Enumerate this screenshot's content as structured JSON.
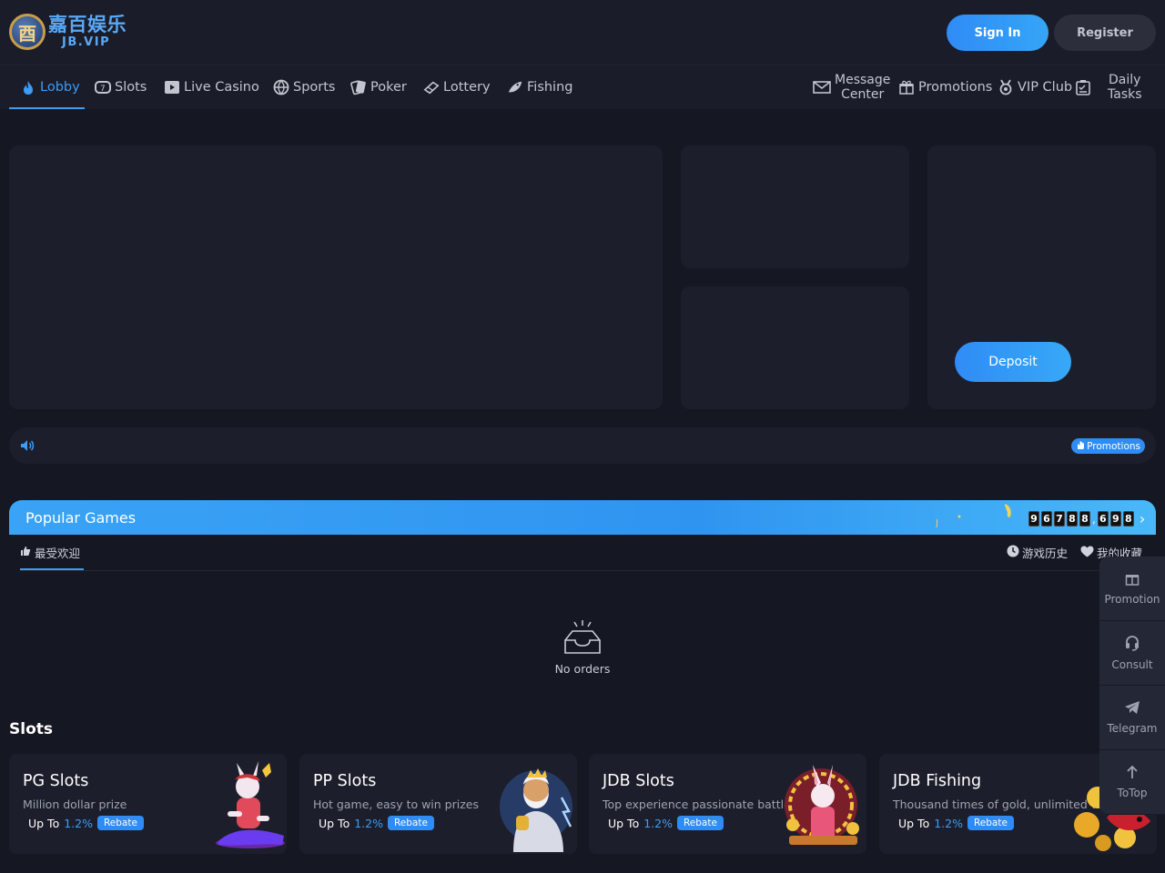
{
  "header": {
    "logo_mark": "酉",
    "logo_cn": "嘉百娱乐",
    "logo_en": "JB.VIP",
    "sign_in": "Sign In",
    "register": "Register"
  },
  "nav": {
    "items": [
      {
        "label": "Lobby",
        "icon": "flame-icon"
      },
      {
        "label": "Slots",
        "icon": "slot-machine-icon"
      },
      {
        "label": "Live Casino",
        "icon": "play-icon"
      },
      {
        "label": "Sports",
        "icon": "ball-icon"
      },
      {
        "label": "Poker",
        "icon": "cards-icon"
      },
      {
        "label": "Lottery",
        "icon": "lottery-icon"
      },
      {
        "label": "Fishing",
        "icon": "fish-icon"
      }
    ],
    "right": {
      "message_line1": "Message",
      "message_line2": "Center",
      "promotions": "Promotions",
      "vip": "VIP Club",
      "daily_line1": "Daily",
      "daily_line2": "Tasks"
    }
  },
  "banner": {
    "deposit": "Deposit"
  },
  "marquee": {
    "promotions": "Promotions"
  },
  "popular": {
    "title": "Popular Games",
    "jackpot_digits": [
      "9",
      "6",
      "7",
      "8",
      "8",
      "6",
      "9",
      "8"
    ],
    "jackpot_sep": ",",
    "tab_favorite": "最受欢迎",
    "tab_history": "游戏历史",
    "tab_collection": "我的收藏",
    "empty_text": "No orders"
  },
  "slots": {
    "title": "Slots",
    "cards": [
      {
        "title": "PG Slots",
        "sub": "Million dollar prize",
        "up_to": "Up To",
        "pct": "1.2%",
        "tag": "Rebate"
      },
      {
        "title": "PP Slots",
        "sub": "Hot game, easy to win prizes",
        "up_to": "Up To",
        "pct": "1.2%",
        "tag": "Rebate"
      },
      {
        "title": "JDB Slots",
        "sub": "Top experience passionate battle",
        "up_to": "Up To",
        "pct": "1.2%",
        "tag": "Rebate"
      },
      {
        "title": "JDB Fishing",
        "sub": "Thousand times of gold, unlimited w",
        "up_to": "Up To",
        "pct": "1.2%",
        "tag": "Rebate"
      }
    ]
  },
  "side": {
    "promotion": "Promotion",
    "consult": "Consult",
    "telegram": "Telegram",
    "totop": "ToTop"
  },
  "colors": {
    "accent": "#3d9cf5",
    "bg": "#151823",
    "panel": "#1c1f2b"
  }
}
